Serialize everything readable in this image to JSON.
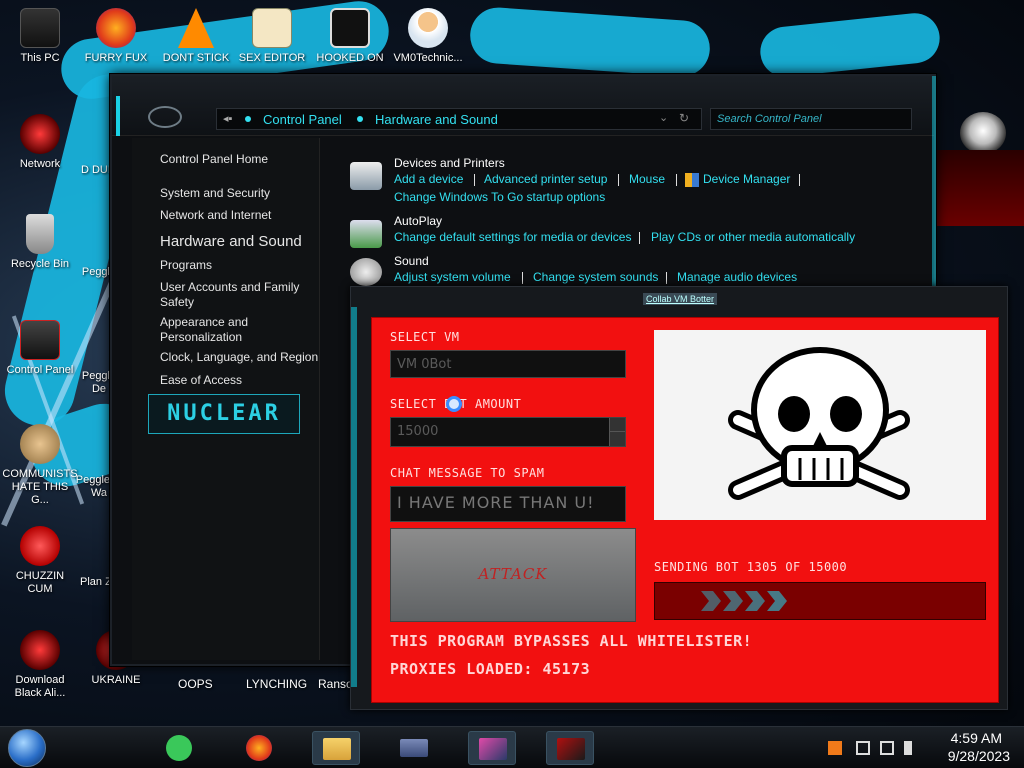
{
  "desktop": {
    "top_icons": [
      "This PC",
      "FURRY FUX",
      "DONT STICK",
      "SEX EDITOR",
      "HOOKED ON",
      "VM0Technic..."
    ],
    "left_icons": [
      "Network",
      "Recycle Bin",
      "Control Panel",
      "COMMUNISTS HATE THIS G...",
      "CHUZZIN CUM",
      "Download Black Ali..."
    ],
    "second_column": [
      "D DUM",
      "Peggle",
      "Peggle De",
      "Peggle of Wa",
      "Plan Zo",
      "UKRAINE"
    ],
    "bottom_labels": [
      "OOPS",
      "LYNCHING",
      "Ranso"
    ]
  },
  "control_panel": {
    "breadcrumb": [
      "Control Panel",
      "Hardware and Sound"
    ],
    "search_placeholder": "Search Control Panel",
    "sidebar": {
      "home": "Control Panel Home",
      "items": [
        "System and Security",
        "Network and Internet",
        "Hardware and Sound",
        "Programs",
        "User Accounts and Family Safety",
        "Appearance and Personalization",
        "Clock, Language, and Region",
        "Ease of Access"
      ],
      "logo_text": "NUCLEAR"
    },
    "categories": {
      "devices": {
        "title": "Devices and Printers",
        "links": [
          "Add a device",
          "Advanced printer setup",
          "Mouse",
          "Device Manager",
          "Change Windows To Go startup options"
        ]
      },
      "autoplay": {
        "title": "AutoPlay",
        "links": [
          "Change default settings for media or devices",
          "Play CDs or other media automatically"
        ]
      },
      "sound": {
        "title": "Sound",
        "links": [
          "Adjust system volume",
          "Change system sounds",
          "Manage audio devices"
        ]
      }
    }
  },
  "bot_app": {
    "title": "Collab VM Botter",
    "select_vm_label": "SELECT VM",
    "select_vm_value": "VM 0Bot",
    "bot_amount_label": "SELECT BOT AMOUNT",
    "bot_amount_value": "15000",
    "chat_label": "CHAT MESSAGE TO SPAM",
    "chat_value": "I HAVE MORE THAN U!",
    "attack_label": "ATTACK",
    "sending_status": "SENDING BOT 1305 OF 15000",
    "progress_fraction": 0.09,
    "bypass_text": "THIS PROGRAM BYPASSES ALL WHITELISTER!",
    "proxies_text": "PROXIES LOADED: 45173",
    "image_icon": "skull-and-crossbones-icon"
  },
  "taskbar": {
    "clock_time": "4:59 AM",
    "clock_date": "9/28/2023",
    "pinned": [
      "spotify-icon",
      "firefox-icon",
      "file-explorer-icon",
      "app-icon",
      "photos-icon",
      "media-icon"
    ]
  },
  "colors": {
    "accent_cyan": "#33e0f0",
    "bot_red": "#f21010",
    "progress_cyan": "#1fd7ee"
  }
}
